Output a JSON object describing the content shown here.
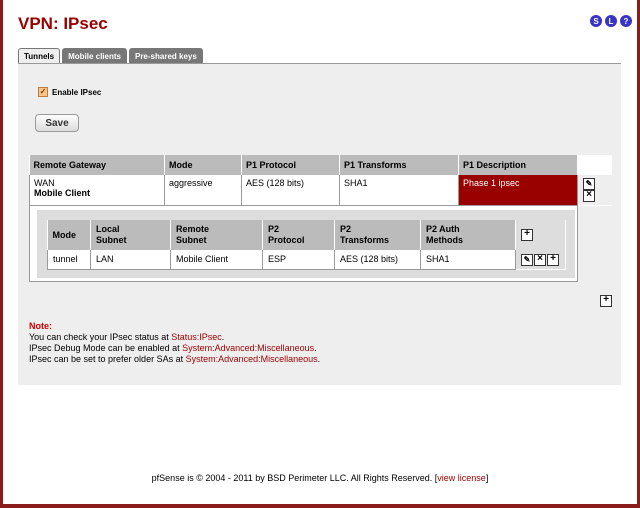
{
  "page": {
    "title": "VPN: IPsec"
  },
  "top_icons": [
    "S",
    "L",
    "?"
  ],
  "tabs": [
    {
      "label": "Tunnels",
      "active": true
    },
    {
      "label": "Mobile clients",
      "active": false
    },
    {
      "label": "Pre-shared keys",
      "active": false
    }
  ],
  "enable": {
    "label": "Enable IPsec",
    "checked": true
  },
  "save": {
    "label": "Save"
  },
  "phase1": {
    "headers": [
      "Remote Gateway",
      "Mode",
      "P1 Protocol",
      "P1 Transforms",
      "P1 Description"
    ],
    "row": {
      "gateway_line1": "WAN",
      "gateway_line2": "Mobile Client",
      "mode": "aggressive",
      "protocol": "AES (128 bits)",
      "transforms": "SHA1",
      "description": "Phase 1 ipsec"
    }
  },
  "phase2": {
    "headers": [
      {
        "l1": "Mode",
        "l2": ""
      },
      {
        "l1": "Local",
        "l2": "Subnet"
      },
      {
        "l1": "Remote",
        "l2": "Subnet"
      },
      {
        "l1": "P2",
        "l2": "Protocol"
      },
      {
        "l1": "P2",
        "l2": "Transforms"
      },
      {
        "l1": "P2 Auth",
        "l2": "Methods"
      }
    ],
    "row": {
      "mode": "tunnel",
      "local": "LAN",
      "remote": "Mobile Client",
      "protocol": "ESP",
      "transforms": "AES (128 bits)",
      "auth": "SHA1"
    }
  },
  "note": {
    "title": "Note:",
    "line1_text": "You can check your IPsec status at ",
    "line1_link": "Status:IPsec",
    "line2_text": "IPsec Debug Mode can be enabled at ",
    "line2_link": "System:Advanced:Miscellaneous",
    "line3_text": "IPsec can be set to prefer older SAs at ",
    "line3_link": "System:Advanced:Miscellaneous"
  },
  "footer": {
    "text": "pfSense is © 2004 - 2011 by BSD Perimeter LLC. All Rights Reserved. [",
    "link": "view license",
    "end": "]"
  }
}
